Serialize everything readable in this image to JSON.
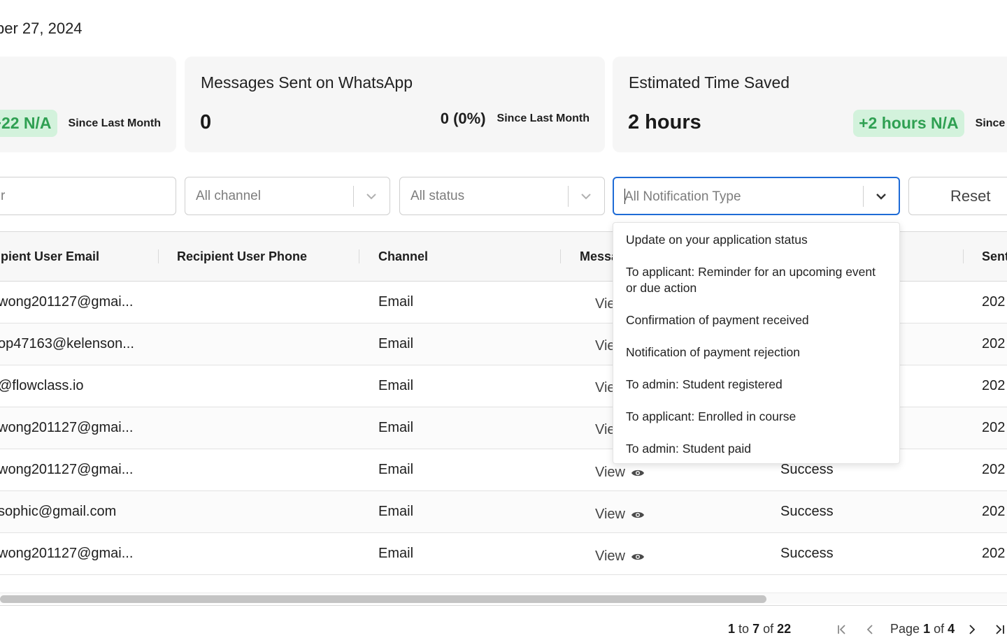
{
  "header": {
    "date_text": "ber 27, 2024"
  },
  "cards": [
    {
      "title": "",
      "value": "",
      "delta": "+22 N/A",
      "since": "Since Last Month"
    },
    {
      "title": "Messages Sent on WhatsApp",
      "value": "0",
      "delta": "0 (0%)",
      "since": "Since Last Month"
    },
    {
      "title": "Estimated Time Saved",
      "value": "2 hours",
      "delta": "+2 hours N/A",
      "since": "Since Last Mon"
    }
  ],
  "filters": {
    "search_placeholder": "r",
    "channel_placeholder": "All channel",
    "status_placeholder": "All status",
    "notification_type_placeholder": "All Notification Type",
    "reset_label": "Reset"
  },
  "table": {
    "columns": [
      "ipient User Email",
      "Recipient User Phone",
      "Channel",
      "Messa",
      "Sent"
    ],
    "rows": [
      {
        "email": "wong201127@gmai...",
        "phone": "",
        "channel": "Email",
        "message": "Vie",
        "status": "",
        "sent": "202"
      },
      {
        "email": "op47163@kelenson...",
        "phone": "",
        "channel": "Email",
        "message": "Vie",
        "status": "",
        "sent": "202"
      },
      {
        "email": "@flowclass.io",
        "phone": "",
        "channel": "Email",
        "message": "Vie",
        "status": "",
        "sent": "202"
      },
      {
        "email": "wong201127@gmai...",
        "phone": "",
        "channel": "Email",
        "message": "Vie",
        "status": "",
        "sent": "202"
      },
      {
        "email": "wong201127@gmai...",
        "phone": "",
        "channel": "Email",
        "message": "View",
        "status": "Success",
        "sent": "202"
      },
      {
        "email": "sophic@gmail.com",
        "phone": "",
        "channel": "Email",
        "message": "View",
        "status": "Success",
        "sent": "202"
      },
      {
        "email": "wong201127@gmai...",
        "phone": "",
        "channel": "Email",
        "message": "View",
        "status": "Success",
        "sent": "202"
      }
    ]
  },
  "dropdown": {
    "options": [
      "Update on your application status",
      "To applicant: Reminder for an upcoming event or due action",
      "Confirmation of payment received",
      "Notification of payment rejection",
      "To admin: Student registered",
      "To applicant: Enrolled in course",
      "To admin: Student paid"
    ]
  },
  "pagination": {
    "range_start": "1",
    "range_to": "to",
    "range_end": "7",
    "range_of": "of",
    "total": "22",
    "page_label": "Page",
    "page_current": "1",
    "page_of": "of",
    "page_total": "4"
  },
  "colors": {
    "accent": "#1e6bd6",
    "positive_bg": "#d3f2dc",
    "positive_text": "#2fa052"
  }
}
